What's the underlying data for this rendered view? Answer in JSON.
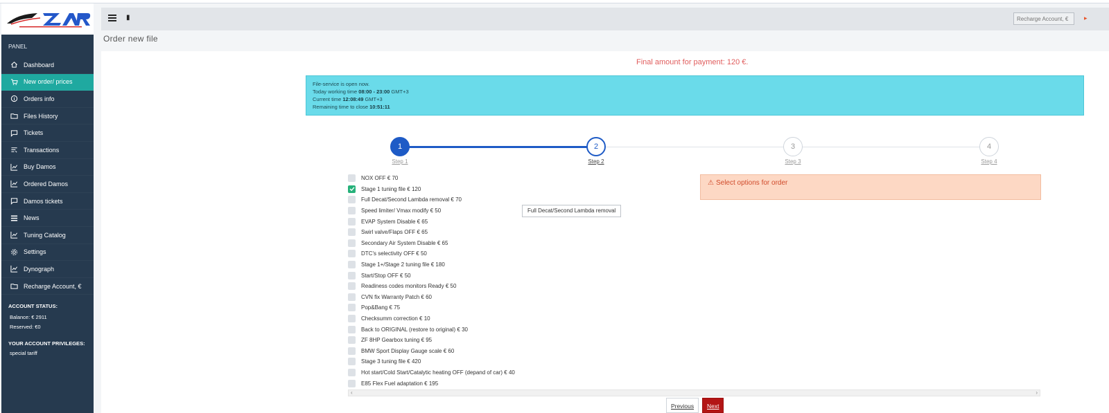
{
  "sidebar": {
    "panel_label": "PANEL",
    "items": [
      {
        "label": "Dashboard",
        "icon": "home-icon"
      },
      {
        "label": "New order/ prices",
        "icon": "cart-icon",
        "active": true
      },
      {
        "label": "Orders info",
        "icon": "info-icon"
      },
      {
        "label": "Files History",
        "icon": "folder-icon"
      },
      {
        "label": "Tickets",
        "icon": "chat-icon"
      },
      {
        "label": "Transactions",
        "icon": "transactions-icon"
      },
      {
        "label": "Buy Damos",
        "icon": "chart-icon"
      },
      {
        "label": "Ordered Damos",
        "icon": "chart-icon"
      },
      {
        "label": "Damos tickets",
        "icon": "chat-icon"
      },
      {
        "label": "News",
        "icon": "list-icon"
      },
      {
        "label": "Tuning Catalog",
        "icon": "chart-icon"
      },
      {
        "label": "Settings",
        "icon": "gear-icon"
      },
      {
        "label": "Dynograph",
        "icon": "chart-icon"
      },
      {
        "label": "Recharge Account, €",
        "icon": "folder-icon"
      }
    ],
    "account": {
      "status_label": "ACCOUNT STATUS:",
      "balance": "Balance: € 2911",
      "reserved": "Reserved: €0",
      "privileges_label": "YOUR ACCOUNT PRIVILEGES:",
      "privilege": "special tariff"
    }
  },
  "header": {
    "recharge_placeholder": "Recharge Account, €"
  },
  "page_title": "Order new file",
  "final_amount": "Final amount for payment: 120 €.",
  "info": {
    "line1": "File-service is open now.",
    "working_label": "Today working time ",
    "working_value": "08:00 - 23:00",
    "working_tz": " GMT+3",
    "current_label": "Current time ",
    "current_value": "12:08:49",
    "current_tz": " GMT+3",
    "remaining_label": "Remaining time to close ",
    "remaining_value": "10:51:11"
  },
  "steps": [
    {
      "num": "1",
      "label": "Step 1",
      "state": "done"
    },
    {
      "num": "2",
      "label": "Step 2",
      "state": "current"
    },
    {
      "num": "3",
      "label": "Step 3",
      "state": "todo"
    },
    {
      "num": "4",
      "label": "Step 4",
      "state": "todo"
    }
  ],
  "options": [
    {
      "label": "NOX OFF € 70",
      "checked": false
    },
    {
      "label": "Stage 1 tuning file € 120",
      "checked": true
    },
    {
      "label": "Full Decat/Second Lambda removal € 70",
      "checked": false
    },
    {
      "label": "Speed limiter/ Vmax modify € 50",
      "checked": false
    },
    {
      "label": "EVAP System Disable € 65",
      "checked": false
    },
    {
      "label": "Swirl valve/Flaps OFF € 65",
      "checked": false
    },
    {
      "label": "Secondary Air System Disable € 65",
      "checked": false
    },
    {
      "label": "DTC's selectivity OFF € 50",
      "checked": false
    },
    {
      "label": "Stage 1+/Stage 2 tuning file € 180",
      "checked": false
    },
    {
      "label": "Start/Stop OFF € 50",
      "checked": false
    },
    {
      "label": "Readiness codes monitors Ready € 50",
      "checked": false
    },
    {
      "label": "CVN fix Warranty Patch € 60",
      "checked": false
    },
    {
      "label": "Pop&Bang € 75",
      "checked": false
    },
    {
      "label": "Checksumm correction € 10",
      "checked": false
    },
    {
      "label": "Back to ORIGINAL (restore to original) € 30",
      "checked": false
    },
    {
      "label": "ZF 8HP Gearbox tuning € 95",
      "checked": false
    },
    {
      "label": "BMW Sport Display Gauge scale € 60",
      "checked": false
    },
    {
      "label": "Stage 3 tuning file € 420",
      "checked": false
    },
    {
      "label": "Hot start/Cold Start/Catalytic heating OFF (depand of car) € 40",
      "checked": false
    },
    {
      "label": "E85 Flex Fuel adaptation € 195",
      "checked": false
    }
  ],
  "tooltip": "Full Decat/Second Lambda removal",
  "alert": "Select options for order",
  "buttons": {
    "previous": "Previous",
    "next": "Next"
  },
  "colors": {
    "sidebar_bg": "#263a4f",
    "active_item": "#1fa9a0",
    "step_blue": "#1e5bc6",
    "info_bg": "#6adbea",
    "alert_bg": "#fdd8c4",
    "next_button": "#b31515",
    "checked_green": "#26b17a"
  }
}
